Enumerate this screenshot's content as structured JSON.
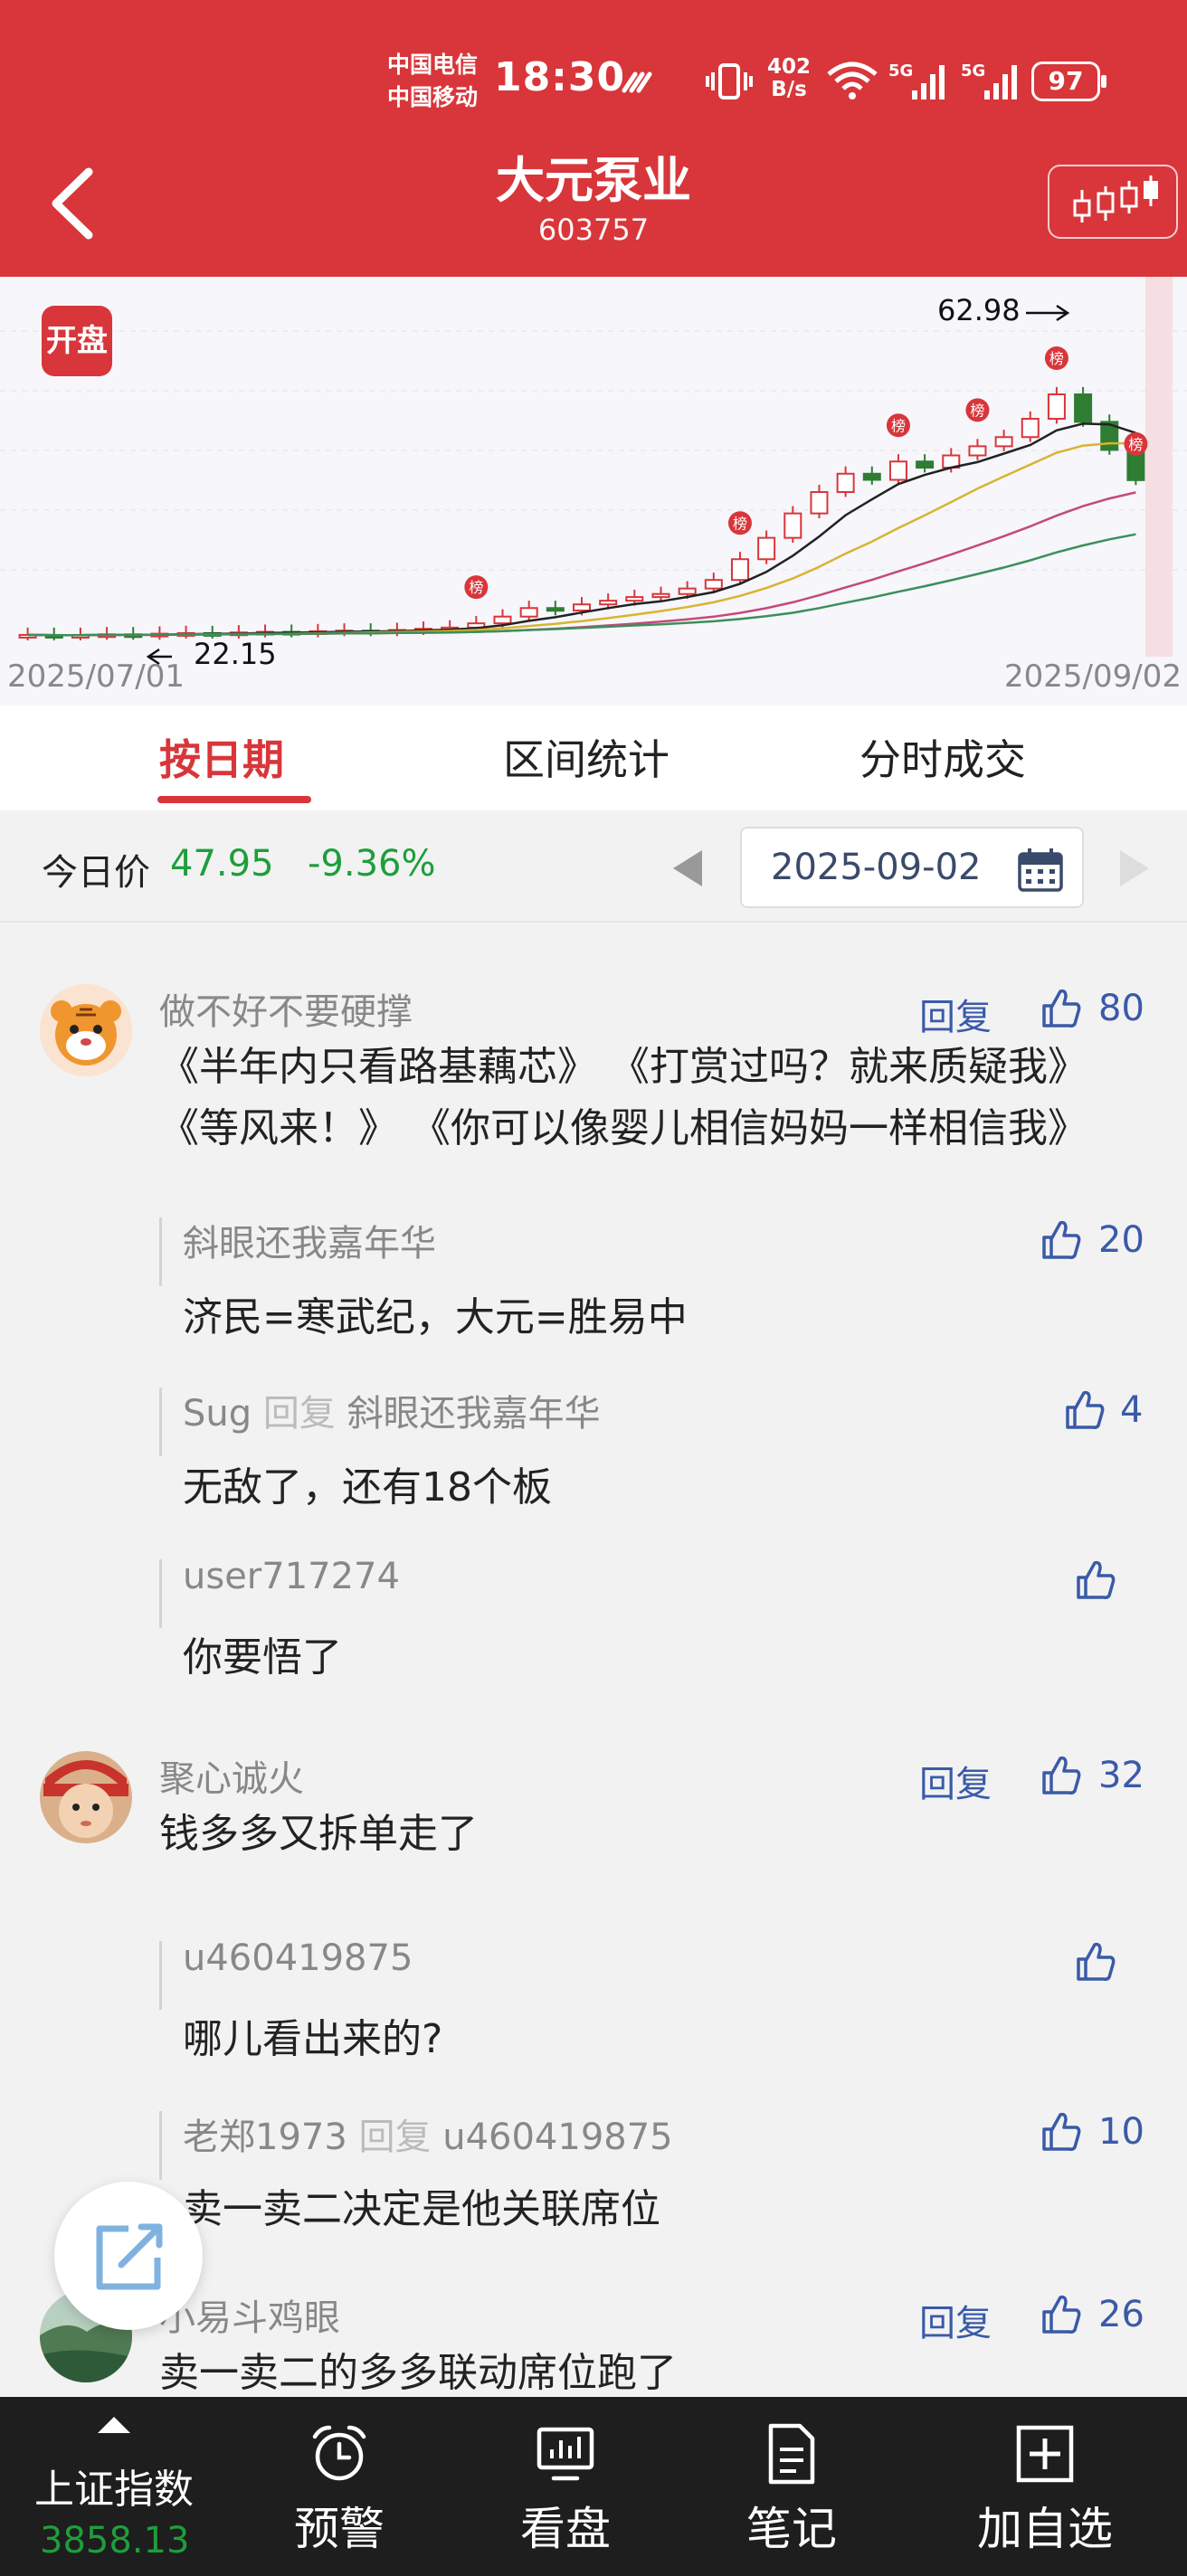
{
  "status_bar": {
    "carrier_1": "中国电信",
    "carrier_2": "中国移动",
    "time": "18:30",
    "net_speed_value": "402",
    "net_speed_unit": "B/s",
    "signal_1": "5G",
    "signal_2": "5G",
    "battery": "97"
  },
  "header": {
    "stock_name": "大元泵业",
    "stock_code": "603757",
    "background_color": "#d8363a"
  },
  "chart": {
    "open_badge": "开盘",
    "high_label": "62.98",
    "low_label": "22.15",
    "start_date": "2025/07/01",
    "end_date": "2025/09/02",
    "marker_label": "榜"
  },
  "chart_data": {
    "type": "candlestick",
    "x_range": [
      "2025/07/01",
      "2025/09/02"
    ],
    "annotations": [
      {
        "label": "62.98",
        "type": "high"
      },
      {
        "label": "22.15",
        "type": "low"
      }
    ],
    "series": [
      {
        "name": "MA5",
        "color": "#222222"
      },
      {
        "name": "MA10",
        "color": "#d8b431"
      },
      {
        "name": "MA20",
        "color": "#c34a78"
      },
      {
        "name": "MA30",
        "color": "#3c8f5a"
      }
    ],
    "up_color": "#d8363a",
    "down_color": "#2e7d32"
  },
  "tabs": [
    {
      "label": "按日期",
      "active": true
    },
    {
      "label": "区间统计",
      "active": false
    },
    {
      "label": "分时成交",
      "active": false
    }
  ],
  "price_bar": {
    "label": "今日价",
    "price": "47.95",
    "change": "-9.36%",
    "date": "2025-09-02"
  },
  "comments": [
    {
      "author": "做不好不要硬撑",
      "reply_label": "回复",
      "likes": "80",
      "lines": [
        "《半年内只看路基藕芯》 《打赏过吗？就来质疑我》",
        "《等风来！》 《你可以像婴儿相信妈妈一样相信我》"
      ],
      "replies": [
        {
          "author": "斜眼还我嘉年华",
          "reply_word": "",
          "reply_to": "",
          "likes": "20",
          "text": "济民=寒武纪，大元=胜易中"
        },
        {
          "author": "Sug",
          "reply_word": "回复",
          "reply_to": "斜眼还我嘉年华",
          "likes": "4",
          "text": "无敌了，还有18个板"
        },
        {
          "author": "user717274",
          "reply_word": "",
          "reply_to": "",
          "likes": "",
          "text": "你要悟了"
        }
      ]
    },
    {
      "author": "聚心诚火",
      "reply_label": "回复",
      "likes": "32",
      "lines": [
        "钱多多又拆单走了"
      ],
      "replies": [
        {
          "author": "u460419875",
          "reply_word": "",
          "reply_to": "",
          "likes": "",
          "text": "哪儿看出来的?"
        },
        {
          "author": "老郑1973",
          "reply_word": "回复",
          "reply_to": "u460419875",
          "likes": "10",
          "text": "卖一卖二决定是他关联席位"
        }
      ]
    },
    {
      "author": "小易斗鸡眼",
      "reply_label": "回复",
      "likes": "26",
      "lines": [
        "卖一卖二的多多联动席位跑了"
      ],
      "replies": []
    }
  ],
  "bottom_bar": {
    "index_name": "上证指数",
    "index_value": "3858.13",
    "items": [
      {
        "label": "预警",
        "icon": "alarm-clock-icon"
      },
      {
        "label": "看盘",
        "icon": "monitor-chart-icon"
      },
      {
        "label": "笔记",
        "icon": "document-icon"
      },
      {
        "label": "加自选",
        "icon": "add-box-icon"
      }
    ]
  }
}
